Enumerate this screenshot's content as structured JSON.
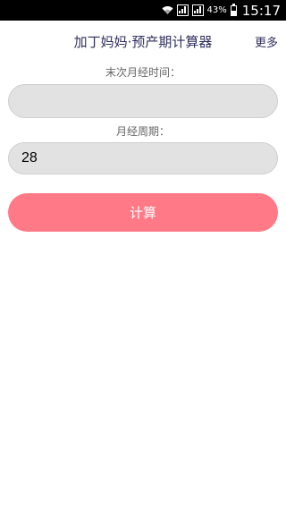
{
  "status_bar": {
    "battery_percent": "43%",
    "battery_level": 0.43,
    "time": "15:17",
    "icons": [
      "wifi-icon",
      "signal-icon-1",
      "signal-icon-2",
      "battery-icon"
    ]
  },
  "header": {
    "title": "加丁妈妈·预产期计算器",
    "more_label": "更多"
  },
  "form": {
    "last_period_label": "末次月经时间：",
    "last_period_value": "",
    "cycle_label": "月经周期：",
    "cycle_value": "28"
  },
  "calculate_button": {
    "label": "计算",
    "color": "#ff7a86"
  }
}
